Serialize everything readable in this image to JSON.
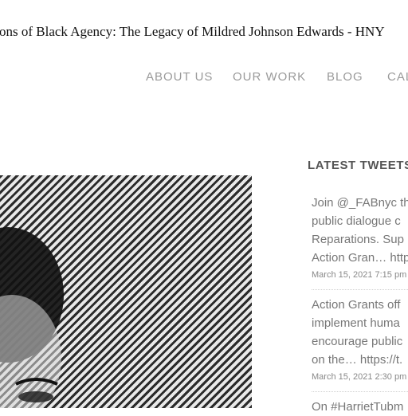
{
  "tab": {
    "title": "ations of Black Agency: The Legacy of Mildred Johnson Edwards - HNY"
  },
  "nav": {
    "items": [
      {
        "label": "ABOUT US"
      },
      {
        "label": "OUR WORK"
      },
      {
        "label": "BLOG"
      },
      {
        "label": "CAL"
      }
    ]
  },
  "sidebar": {
    "title": "LATEST TWEETS",
    "tweets": [
      {
        "lines": [
          "Join @_FABnyc th",
          "public dialogue c",
          "Reparations. Sup",
          "Action Gran… http"
        ],
        "date": "March 15, 2021 7:15 pm"
      },
      {
        "lines": [
          "Action Grants off",
          "implement huma",
          "encourage public",
          "on the… https://t."
        ],
        "date": "March 15, 2021 2:30 pm"
      },
      {
        "lines": [
          "On #HarrietTubm"
        ],
        "date": ""
      }
    ]
  }
}
